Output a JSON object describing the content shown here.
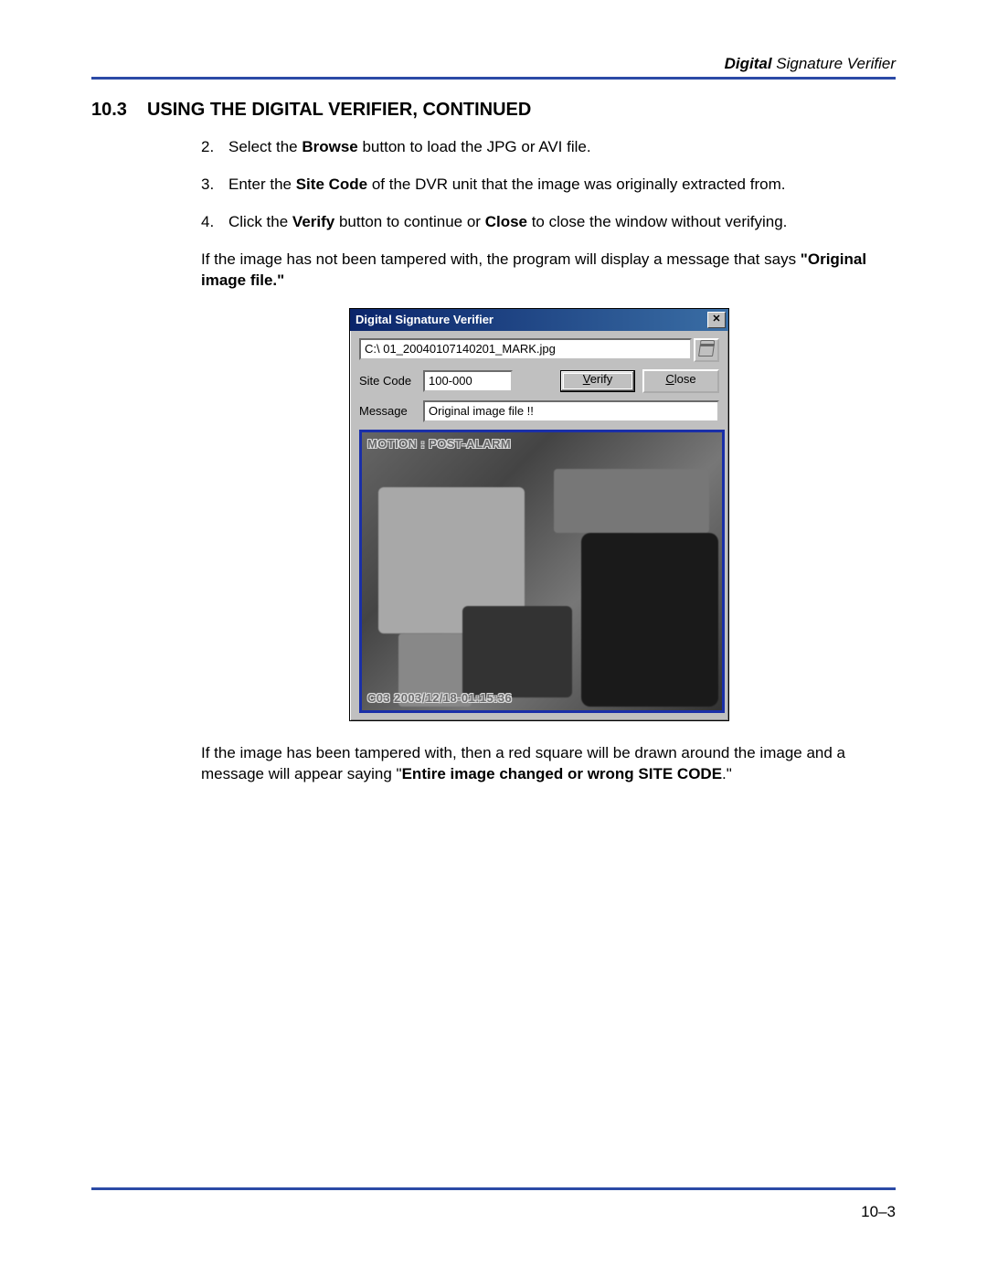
{
  "header": {
    "bold": "Digital",
    "rest": " Signature Verifier"
  },
  "section": {
    "num": "10.3",
    "title": "USING THE DIGITAL VERIFIER, CONTINUED"
  },
  "steps": [
    {
      "num": "2.",
      "pre": "Select the ",
      "bold": "Browse",
      "post": " button to load the JPG or AVI file."
    },
    {
      "num": "3.",
      "pre": "Enter the ",
      "bold": "Site Code",
      "post": " of the DVR unit that the image was originally extracted from."
    },
    {
      "num": "4.",
      "pre": "Click the ",
      "bold": "Verify",
      "mid": " button to continue or ",
      "bold2": "Close",
      "post": " to close the window without verifying."
    }
  ],
  "para1": {
    "pre": "If the image has not been tampered with, the program will display a message that says ",
    "bold": "\"Original image file.\""
  },
  "dialog": {
    "title": "Digital Signature Verifier",
    "path": "C:\\ 01_20040107140201_MARK.jpg",
    "site_code_label": "Site Code",
    "site_code_value": "100-000",
    "verify_btn": "Verify",
    "close_btn": "Close",
    "message_label": "Message",
    "message_value": "Original image file !!",
    "overlay_top": "MOTION : POST-ALARM",
    "overlay_bottom": "C03 2003/12/18-01:15:36"
  },
  "para2": {
    "pre": "If the image has been tampered with, then a red square will be drawn around the image and a message will appear saying \"",
    "bold": "Entire image changed or wrong SITE CODE",
    "post": ".\""
  },
  "page_number": "10–3"
}
